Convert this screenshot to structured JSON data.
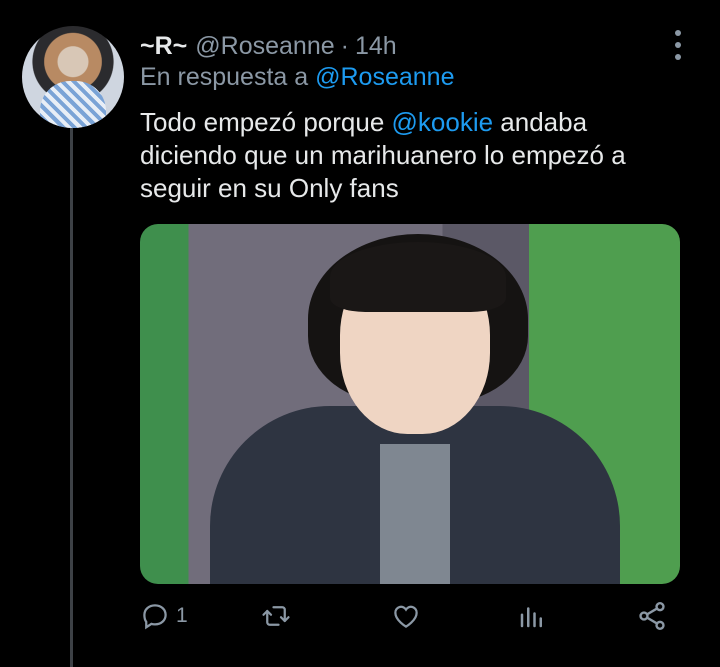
{
  "tweet": {
    "display_name": "~R~",
    "handle": "@Roseanne",
    "separator": "·",
    "time": "14h",
    "reply_prefix": "En respuesta a",
    "reply_handle": "@Roseanne",
    "text_before": "Todo empezó porque ",
    "text_mention": "@kookie",
    "text_after": " andaba diciendo que un marihuanero lo empezó a seguir en su Only fans"
  },
  "actions": {
    "reply_count": "1",
    "icons": [
      "reply-icon",
      "retweet-icon",
      "like-icon",
      "analytics-icon",
      "share-icon"
    ]
  },
  "colors": {
    "background": "#000000",
    "text": "#e7e9ea",
    "muted": "#8b98a5",
    "link": "#1d9bf0"
  }
}
